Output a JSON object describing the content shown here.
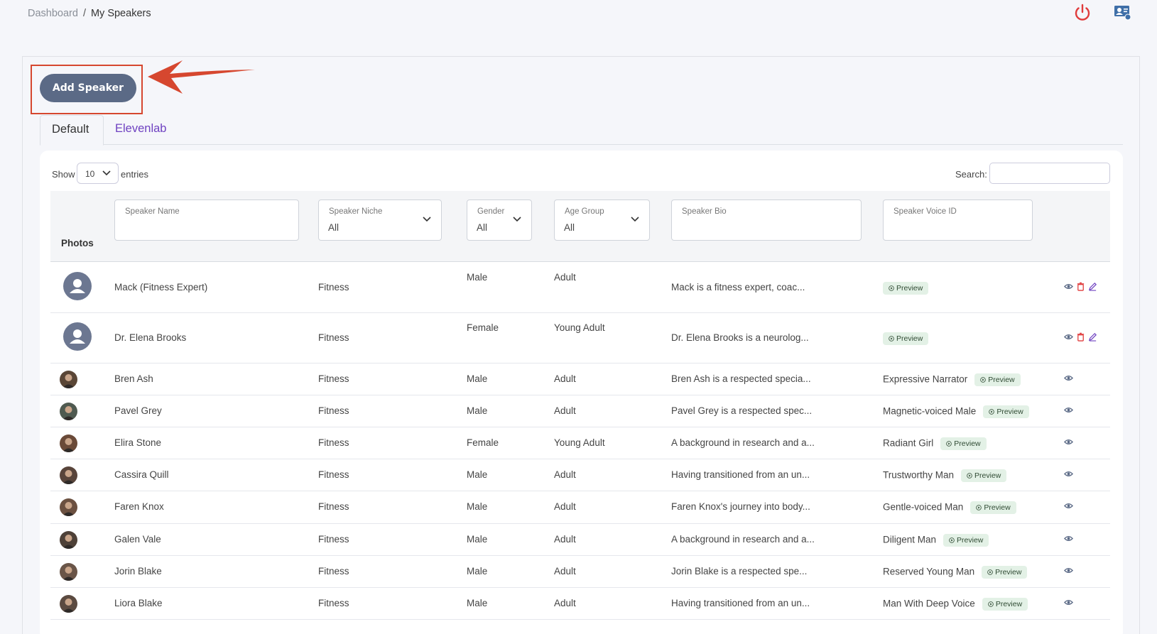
{
  "breadcrumb": {
    "root": "Dashboard",
    "current": "My Speakers"
  },
  "actions": {
    "add_speaker": "Add Speaker"
  },
  "tabs": [
    {
      "label": "Default"
    },
    {
      "label": "Elevenlab"
    }
  ],
  "table_controls": {
    "show": "Show",
    "entries_value": "10",
    "entries": "entries",
    "search_label": "Search:"
  },
  "filters": {
    "photos": "Photos",
    "speaker_name": {
      "label": "Speaker Name",
      "value": ""
    },
    "speaker_niche": {
      "label": "Speaker Niche",
      "value": "All"
    },
    "gender": {
      "label": "Gender",
      "value": "All"
    },
    "age_group": {
      "label": "Age Group",
      "value": "All"
    },
    "speaker_bio": {
      "label": "Speaker Bio",
      "value": ""
    },
    "speaker_voice_id": {
      "label": "Speaker Voice ID",
      "value": ""
    }
  },
  "preview_label": "Preview",
  "rows": [
    {
      "name": "Mack (Fitness Expert)",
      "niche": "Fitness",
      "gender": "Male",
      "age": "Adult",
      "bio": "Mack is a fitness expert, coac...",
      "voice": ""
    },
    {
      "name": "Dr. Elena Brooks",
      "niche": "Fitness",
      "gender": "Female",
      "age": "Young Adult",
      "bio": "Dr. Elena Brooks is a neurolog...",
      "voice": ""
    },
    {
      "name": "Bren Ash",
      "niche": "Fitness",
      "gender": "Male",
      "age": "Adult",
      "bio": "Bren Ash is a respected specia...",
      "voice": "Expressive Narrator"
    },
    {
      "name": "Pavel Grey",
      "niche": "Fitness",
      "gender": "Male",
      "age": "Adult",
      "bio": "Pavel Grey is a respected spec...",
      "voice": "Magnetic-voiced Male"
    },
    {
      "name": "Elira Stone",
      "niche": "Fitness",
      "gender": "Female",
      "age": "Young Adult",
      "bio": "A background in research and a...",
      "voice": "Radiant Girl"
    },
    {
      "name": "Cassira Quill",
      "niche": "Fitness",
      "gender": "Male",
      "age": "Adult",
      "bio": "Having transitioned from an un...",
      "voice": "Trustworthy Man"
    },
    {
      "name": "Faren Knox",
      "niche": "Fitness",
      "gender": "Male",
      "age": "Adult",
      "bio": "Faren Knox's journey into body...",
      "voice": "Gentle-voiced Man"
    },
    {
      "name": "Galen Vale",
      "niche": "Fitness",
      "gender": "Male",
      "age": "Adult",
      "bio": "A background in research and a...",
      "voice": "Diligent Man"
    },
    {
      "name": "Jorin Blake",
      "niche": "Fitness",
      "gender": "Male",
      "age": "Adult",
      "bio": "Jorin Blake is a respected spe...",
      "voice": "Reserved Young Man"
    },
    {
      "name": "Liora Blake",
      "niche": "Fitness",
      "gender": "Male",
      "age": "Adult",
      "bio": "Having transitioned from an un...",
      "voice": "Man With Deep Voice"
    }
  ],
  "colors": {
    "accent": "#6f42c1",
    "button": "#5b6a86",
    "danger": "#e03c3c",
    "highlight": "#d6472f"
  }
}
